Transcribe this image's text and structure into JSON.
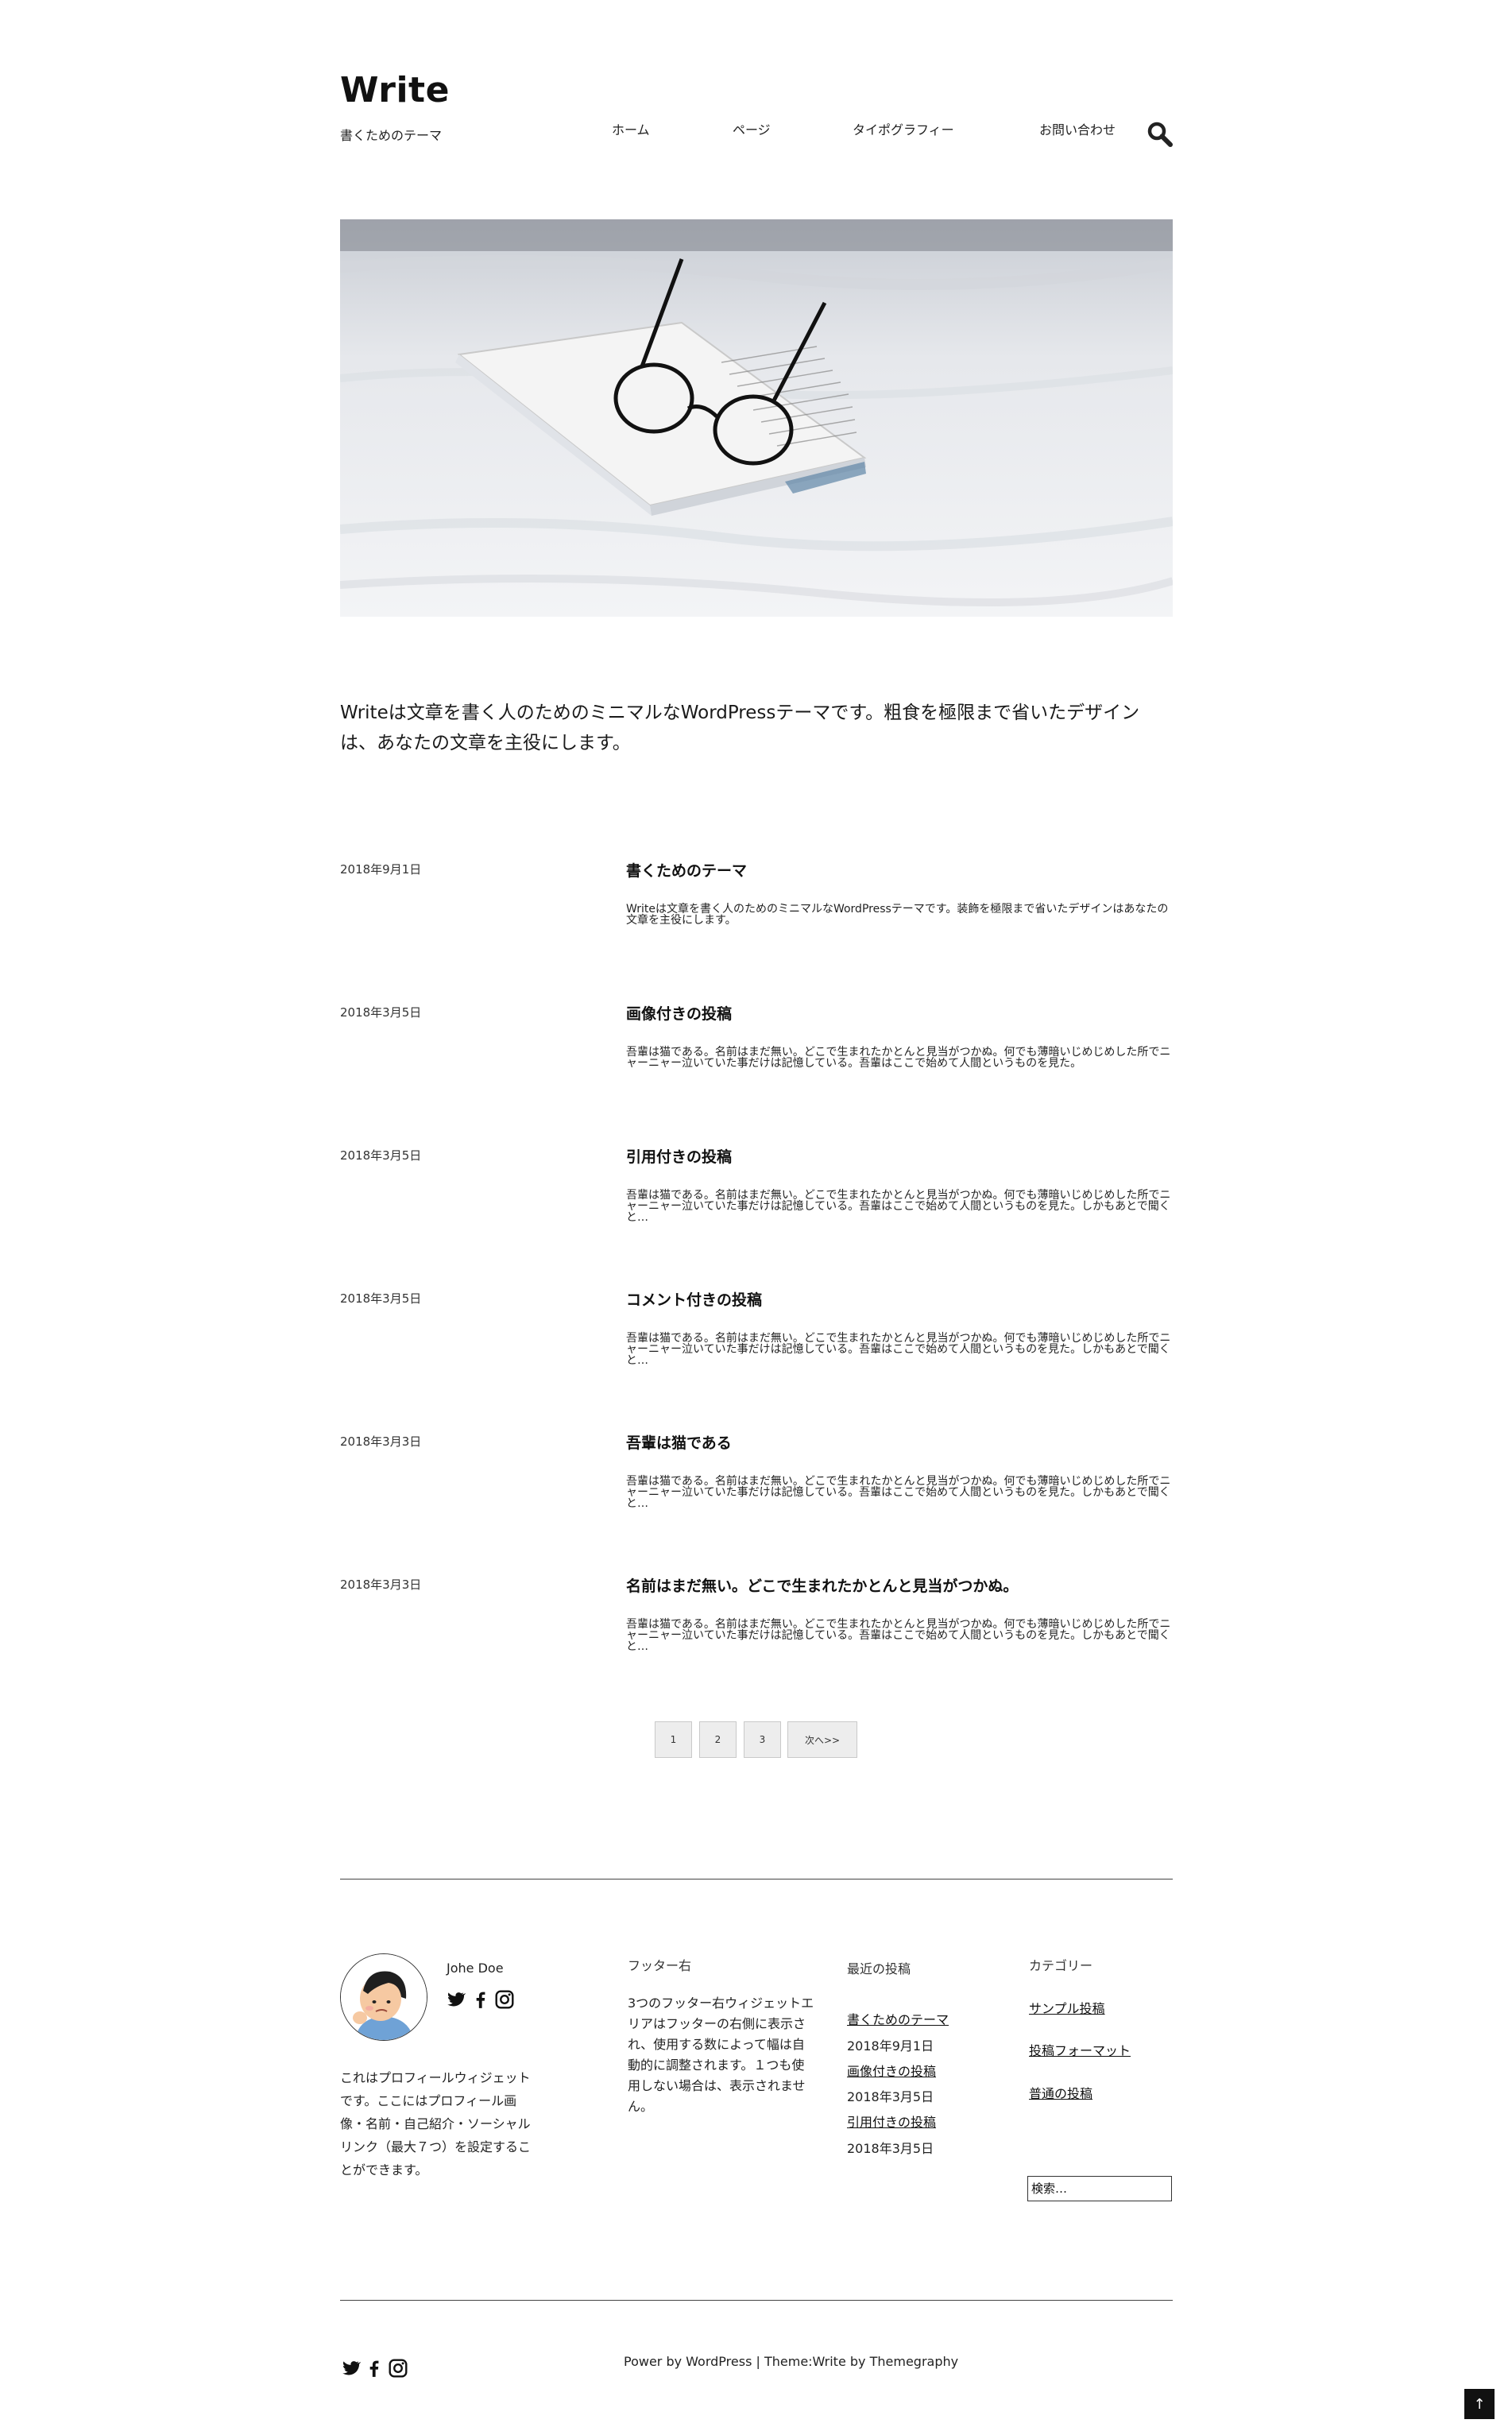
{
  "site": {
    "title": "Write",
    "description": "書くためのテーマ"
  },
  "nav": {
    "items": [
      {
        "label": "ホーム"
      },
      {
        "label": "ページ"
      },
      {
        "label": "タイポグラフィー"
      },
      {
        "label": "お問い合わせ"
      }
    ],
    "search_icon": "search-icon"
  },
  "intro": {
    "text": "Writeは文章を書く人のためのミニマルなWordPressテーマです。粗食を極限まで省いたデザインは、あなたの文章を主役にします。"
  },
  "posts": [
    {
      "date": "2018年9月1日",
      "title": "書くためのテーマ",
      "excerpt": "Writeは文章を書く人のためのミニマルなWordPressテーマです。装飾を極限まで省いたデザインはあなたの文章を主役にします。"
    },
    {
      "date": "2018年3月5日",
      "title": "画像付きの投稿",
      "excerpt": "吾輩は猫である。名前はまだ無い。どこで生まれたかとんと見当がつかぬ。何でも薄暗いじめじめした所でニャーニャー泣いていた事だけは記憶している。吾輩はここで始めて人間というものを見た。"
    },
    {
      "date": "2018年3月5日",
      "title": "引用付きの投稿",
      "excerpt": "吾輩は猫である。名前はまだ無い。どこで生まれたかとんと見当がつかぬ。何でも薄暗いじめじめした所でニャーニャー泣いていた事だけは記憶している。吾輩はここで始めて人間というものを見た。しかもあとで聞くと…"
    },
    {
      "date": "2018年3月5日",
      "title": "コメント付きの投稿",
      "excerpt": "吾輩は猫である。名前はまだ無い。どこで生まれたかとんと見当がつかぬ。何でも薄暗いじめじめした所でニャーニャー泣いていた事だけは記憶している。吾輩はここで始めて人間というものを見た。しかもあとで聞くと…"
    },
    {
      "date": "2018年3月3日",
      "title": "吾輩は猫である",
      "excerpt": "吾輩は猫である。名前はまだ無い。どこで生まれたかとんと見当がつかぬ。何でも薄暗いじめじめした所でニャーニャー泣いていた事だけは記憶している。吾輩はここで始めて人間というものを見た。しかもあとで聞くと…"
    },
    {
      "date": "2018年3月3日",
      "title": "名前はまだ無い。どこで生まれたかとんと見当がつかぬ。",
      "excerpt": "吾輩は猫である。名前はまだ無い。どこで生まれたかとんと見当がつかぬ。何でも薄暗いじめじめした所でニャーニャー泣いていた事だけは記憶している。吾輩はここで始めて人間というものを見た。しかもあとで聞くと…"
    }
  ],
  "pagination": {
    "pages": [
      "1",
      "2",
      "3"
    ],
    "next_label": "次へ>>"
  },
  "profile": {
    "name": "Johe Doe",
    "text": "これはプロフィールウィジェットです。ここにはプロフィール画像・名前・自己紹介・ソーシャルリンク（最大７つ）を設定することができます。",
    "social_icons": [
      "twitter-icon",
      "facebook-icon",
      "instagram-icon"
    ]
  },
  "footer_right": {
    "title": "フッター右",
    "text": "3つのフッター右ウィジェットエリアはフッターの右側に表示され、使用する数によって幅は自動的に調整されます。１つも使用しない場合は、表示されません。"
  },
  "recent_posts": {
    "title": "最近の投稿",
    "items": [
      {
        "title": "書くためのテーマ",
        "date": "2018年9月1日"
      },
      {
        "title": "画像付きの投稿",
        "date": "2018年3月5日"
      },
      {
        "title": "引用付きの投稿",
        "date": "2018年3月5日"
      }
    ]
  },
  "categories": {
    "title": "カテゴリー",
    "items": [
      "サンプル投稿",
      "投稿フォーマット",
      "普通の投稿"
    ]
  },
  "footer_search": {
    "placeholder": "検索…"
  },
  "credits": {
    "prefix": "Power by ",
    "wordpress": "WordPress",
    "separator": " | ",
    "theme_label": "Theme:",
    "theme_name": "Write",
    "by": " by ",
    "author": "Themegraphy"
  },
  "back_to_top": "↑",
  "colors": {
    "text": "#111111",
    "rule": "#444444",
    "button_bg": "#ededed"
  }
}
